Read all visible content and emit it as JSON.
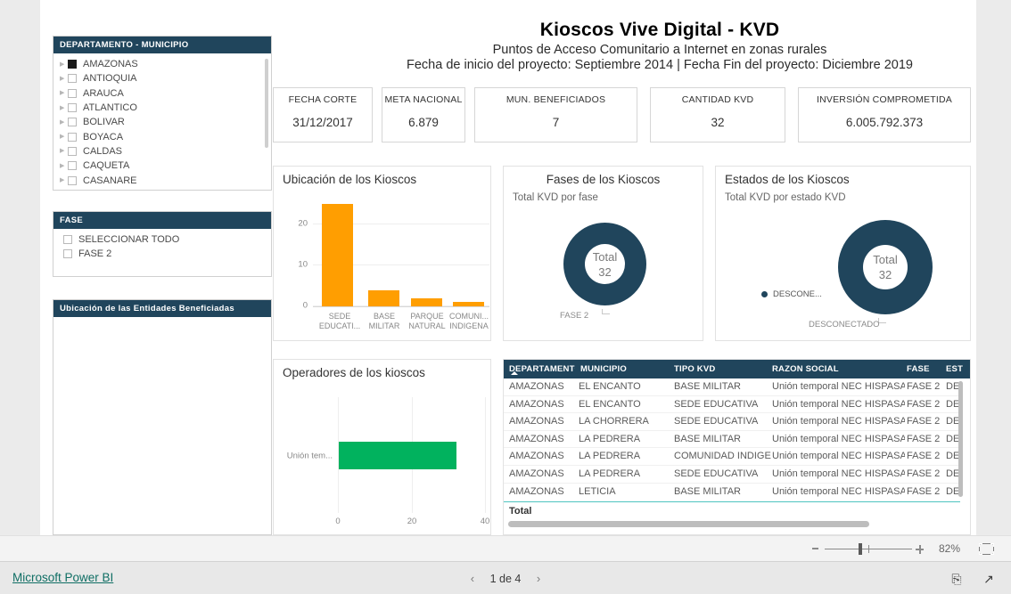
{
  "report": {
    "title": "Kioscos Vive Digital - KVD",
    "subtitle": "Puntos de Acceso Comunitario a Internet en zonas rurales",
    "dates": "Fecha de inicio del proyecto: Septiembre 2014 | Fecha Fin del proyecto: Diciembre 2019"
  },
  "kpis": [
    {
      "label": "FECHA CORTE",
      "value": "31/12/2017"
    },
    {
      "label": "META NACIONAL",
      "value": "6.879"
    },
    {
      "label": "MUN. BENEFICIADOS",
      "value": "7"
    },
    {
      "label": "CANTIDAD KVD",
      "value": "32"
    },
    {
      "label": "INVERSIÓN COMPROMETIDA",
      "value": "6.005.792.373"
    }
  ],
  "slicer_departamento": {
    "header": "DEPARTAMENTO - MUNICIPIO",
    "items": [
      {
        "label": "AMAZONAS",
        "checked": true
      },
      {
        "label": "ANTIOQUIA",
        "checked": false
      },
      {
        "label": "ARAUCA",
        "checked": false
      },
      {
        "label": "ATLANTICO",
        "checked": false
      },
      {
        "label": "BOLIVAR",
        "checked": false
      },
      {
        "label": "BOYACA",
        "checked": false
      },
      {
        "label": "CALDAS",
        "checked": false
      },
      {
        "label": "CAQUETA",
        "checked": false
      },
      {
        "label": "CASANARE",
        "checked": false
      }
    ]
  },
  "slicer_fase": {
    "header": "FASE",
    "items": [
      {
        "label": "SELECCIONAR TODO",
        "checked": false
      },
      {
        "label": "FASE 2",
        "checked": false
      }
    ]
  },
  "map_panel": {
    "header": "Ubicación de  las Entidades Beneficiadas"
  },
  "chart_data": [
    {
      "type": "bar",
      "title": "Ubicación de los Kioscos",
      "subtitle": "",
      "categories": [
        "SEDE EDUCATI...",
        "BASE MILITAR",
        "PARQUE NATURAL",
        "COMUNI... INDIGENA"
      ],
      "category_lines": [
        [
          "SEDE",
          "EDUCATI..."
        ],
        [
          "BASE",
          "MILITAR"
        ],
        [
          "PARQUE",
          "NATURAL"
        ],
        [
          "COMUNI...",
          "INDIGENA"
        ]
      ],
      "values": [
        25,
        4,
        2,
        1
      ],
      "xlabel": "",
      "ylabel": "",
      "ylim": [
        0,
        26
      ],
      "yticks": [
        0,
        10,
        20
      ],
      "grid": true,
      "color": "#ff9e01"
    },
    {
      "type": "pie",
      "title": "Fases de los Kioscos",
      "subtitle": "Total KVD por fase",
      "center_label": "Total",
      "center_value": "32",
      "labels": [
        "FASE 2"
      ],
      "values": [
        32
      ],
      "colors": [
        "#20455c"
      ],
      "legend": "none"
    },
    {
      "type": "pie",
      "title": "Estados de los Kioscos",
      "subtitle": "Total KVD por estado KVD",
      "center_label": "Total",
      "center_value": "32",
      "labels": [
        "DESCONECTADO"
      ],
      "values": [
        32
      ],
      "colors": [
        "#20455c"
      ],
      "legend": "left",
      "legend_entries": [
        "...",
        "DESCONE..."
      ]
    },
    {
      "type": "bar",
      "title": "Operadores de los kioscos",
      "subtitle": "",
      "orientation": "horizontal",
      "categories": [
        "Unión tem..."
      ],
      "values": [
        32
      ],
      "xlim": [
        0,
        40
      ],
      "xticks": [
        0,
        20,
        40
      ],
      "grid": true,
      "color": "#01b25e"
    }
  ],
  "table": {
    "columns": [
      "DEPARTAMENTO",
      "MUNICIPIO",
      "TIPO KVD",
      "RAZON SOCIAL",
      "FASE",
      "EST"
    ],
    "sorted_column": "DEPARTAMENTO",
    "rows": [
      [
        "AMAZONAS",
        "EL ENCANTO",
        "BASE MILITAR",
        "Unión temporal NEC HISPASAT",
        "FASE 2",
        "DE"
      ],
      [
        "AMAZONAS",
        "EL ENCANTO",
        "SEDE EDUCATIVA",
        "Unión temporal NEC HISPASAT",
        "FASE 2",
        "DE"
      ],
      [
        "AMAZONAS",
        "LA CHORRERA",
        "SEDE EDUCATIVA",
        "Unión temporal NEC HISPASAT",
        "FASE 2",
        "DE"
      ],
      [
        "AMAZONAS",
        "LA PEDRERA",
        "BASE MILITAR",
        "Unión temporal NEC HISPASAT",
        "FASE 2",
        "DE"
      ],
      [
        "AMAZONAS",
        "LA PEDRERA",
        "COMUNIDAD INDIGENA",
        "Unión temporal NEC HISPASAT",
        "FASE 2",
        "DE"
      ],
      [
        "AMAZONAS",
        "LA PEDRERA",
        "SEDE EDUCATIVA",
        "Unión temporal NEC HISPASAT",
        "FASE 2",
        "DE"
      ],
      [
        "AMAZONAS",
        "LETICIA",
        "BASE MILITAR",
        "Unión temporal NEC HISPASAT",
        "FASE 2",
        "DE"
      ]
    ],
    "total_label": "Total"
  },
  "zoombar": {
    "percent": "82%"
  },
  "footer": {
    "brand": "Microsoft Power BI",
    "page": "1 de 4",
    "prev": "‹",
    "next": "›"
  }
}
